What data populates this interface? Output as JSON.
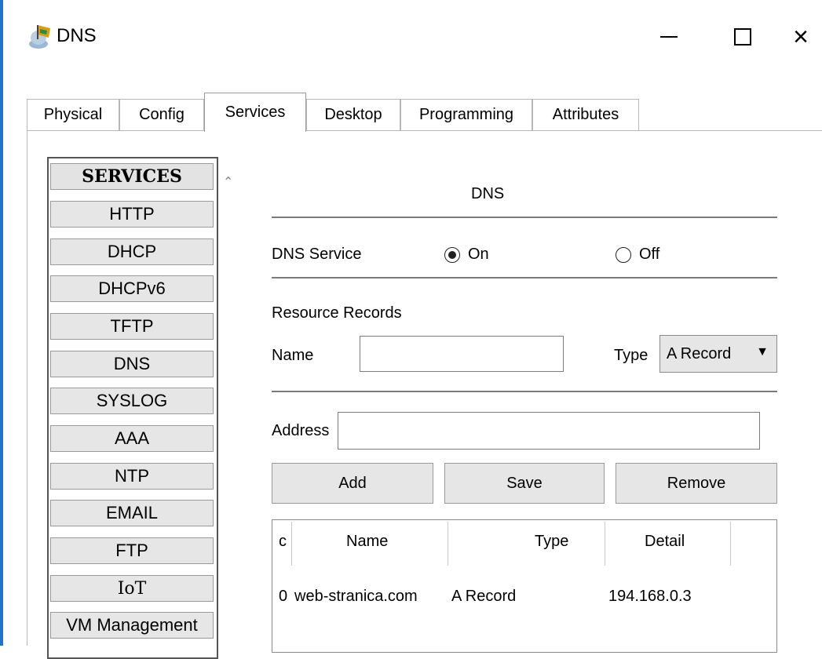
{
  "window": {
    "title": "DNS",
    "icon": "packet-tracer-server-icon",
    "controls": {
      "minimize": "minimize-icon",
      "maximize": "maximize-icon",
      "close": "×"
    }
  },
  "tabs": [
    {
      "label": "Physical",
      "active": false
    },
    {
      "label": "Config",
      "active": false
    },
    {
      "label": "Services",
      "active": true
    },
    {
      "label": "Desktop",
      "active": false
    },
    {
      "label": "Programming",
      "active": false
    },
    {
      "label": "Attributes",
      "active": false
    }
  ],
  "services": {
    "header": "SERVICES",
    "items": [
      "HTTP",
      "DHCP",
      "DHCPv6",
      "TFTP",
      "DNS",
      "SYSLOG",
      "AAA",
      "NTP",
      "EMAIL",
      "FTP",
      "IoT",
      "VM Management"
    ]
  },
  "dns": {
    "section_title": "DNS",
    "service_label": "DNS Service",
    "on_label": "On",
    "off_label": "Off",
    "service_state": "On",
    "resource_records_label": "Resource Records",
    "name_label": "Name",
    "name_value": "",
    "type_label": "Type",
    "type_value": "A Record",
    "address_label": "Address",
    "address_value": "",
    "buttons": {
      "add": "Add",
      "save": "Save",
      "remove": "Remove"
    },
    "table": {
      "headers": [
        "c",
        "Name",
        "Type",
        "Detail"
      ],
      "rows": [
        [
          "0",
          "web-stranica.com",
          "A Record",
          "194.168.0.3"
        ]
      ]
    }
  },
  "colors": {
    "window_accent": "#1f73c9",
    "button_face": "#e6e6e6"
  }
}
